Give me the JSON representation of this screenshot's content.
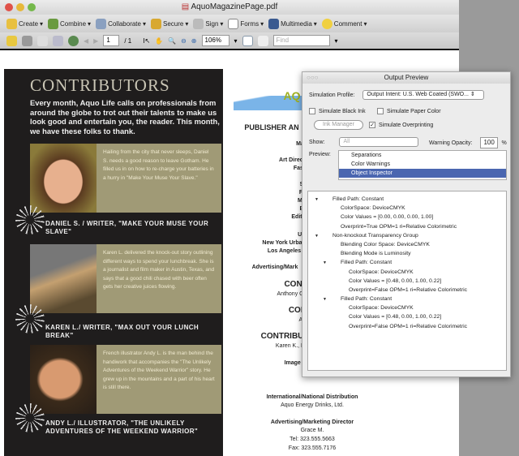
{
  "window": {
    "title": "AquoMagazinePage.pdf"
  },
  "toolbar": {
    "items": [
      "Create",
      "Combine",
      "Collaborate",
      "Secure",
      "Sign",
      "Forms",
      "Multimedia",
      "Comment"
    ]
  },
  "nav": {
    "page": "1",
    "total": "/ 1",
    "zoom": "106%",
    "find_placeholder": "Find"
  },
  "panel": {
    "title": "CONTRIBUTORS",
    "intro": "Every month, Aquo Life calls on professionals from around the globe to trot out their talents to make us look good and entertain you, the reader. This month, we have these folks to thank.",
    "people": [
      {
        "bio": "Hailing from the city that never sleeps, Daniel S. needs a good reason to leave Gotham. He filled us in on how to re-charge your batteries in a hurry in \"Make Your Muse Your Slave.\"",
        "caption": "DANIEL S. / WRITER, \"MAKE YOUR MUSE YOUR SLAVE\""
      },
      {
        "bio": "Karen L. delivered the knock-out story outlining different ways to spend your lunchbreak. She is a journalist and film maker in Austin, Texas, and says that a good chili chased with beer often gets her creative juices flowing.",
        "caption": "KAREN L./ WRITER, \"MAX OUT YOUR LUNCH BREAK\""
      },
      {
        "bio": "French illustrator Andy L. is the man behind the handiwork that accompanies the \"The Unlikely Adventures of the Weekend Warrior\" story. He grew up in the mountains and a part of his heart is still there.",
        "caption": "ANDY L./ ILLUSTRATOR, \"THE UNLIKELY ADVENTURES OF THE WEEKEND WARRIOR\""
      }
    ]
  },
  "masthead": {
    "logo": "AQ",
    "lines": [
      "PUBLISHER AN",
      "Ma",
      "Art Direct",
      "Fash",
      "S",
      "Fi",
      "Mo",
      "B",
      "Edit",
      "Uri",
      "New York Urba",
      "Los Angeles U",
      "Advertising/Mark",
      "CONTI",
      "Anthony G.,",
      "CONT",
      "Arn",
      "CONTRIBU",
      "Karen K., D",
      "Image S",
      "International/National Distribution",
      "Aquo Energy Drinks, Ltd.",
      "Advertising/Marketing Director",
      "Grace M.",
      "Tel: 323.555.5663",
      "Fax: 323.555.7176"
    ]
  },
  "dialog": {
    "title": "Output Preview",
    "sim_profile_label": "Simulation Profile:",
    "sim_profile_value": "Output Intent: U.S. Web Coated (SWO...",
    "black_ink": "Simulate Black Ink",
    "paper_color": "Simulate Paper Color",
    "ink_manager": "Ink Manager",
    "overprinting": "Simulate Overprinting",
    "show_label": "Show:",
    "show_value": "All",
    "warning_label": "Warning Opacity:",
    "warning_value": "100",
    "percent": "%",
    "preview_label": "Preview:",
    "preview_options": [
      "Separations",
      "Color Warnings",
      "Object Inspector"
    ],
    "tree": [
      {
        "level": 0,
        "arrow": true,
        "text": "Filled Path: Constant"
      },
      {
        "level": 1,
        "text": "ColorSpace: DeviceCMYK"
      },
      {
        "level": 1,
        "text": "Color Values = [0.00, 0.00, 0.00, 1.00]"
      },
      {
        "level": 1,
        "text": "Overprint=True OPM=1 ri=Relative Colorimetric"
      },
      {
        "level": 0,
        "arrow": true,
        "text": "Non-knockout Transparency Group"
      },
      {
        "level": 1,
        "text": "Blending Color Space: DeviceCMYK"
      },
      {
        "level": 1,
        "text": "Blending Mode is Luminosity"
      },
      {
        "level": 1,
        "arrow": true,
        "text": "Filled Path: Constant"
      },
      {
        "level": 2,
        "text": "ColorSpace: DeviceCMYK"
      },
      {
        "level": 2,
        "text": "Color Values = [0.48, 0.00, 1.00, 0.22]"
      },
      {
        "level": 2,
        "text": "Overprint=False OPM=1 ri=Relative Colorimetric"
      },
      {
        "level": 1,
        "arrow": true,
        "text": "Filled Path: Constant"
      },
      {
        "level": 2,
        "text": "ColorSpace: DeviceCMYK"
      },
      {
        "level": 2,
        "text": "Color Values = [0.48, 0.00, 1.00, 0.22]"
      },
      {
        "level": 2,
        "text": "Overprint=False OPM=1 ri=Relative Colorimetric"
      }
    ]
  }
}
